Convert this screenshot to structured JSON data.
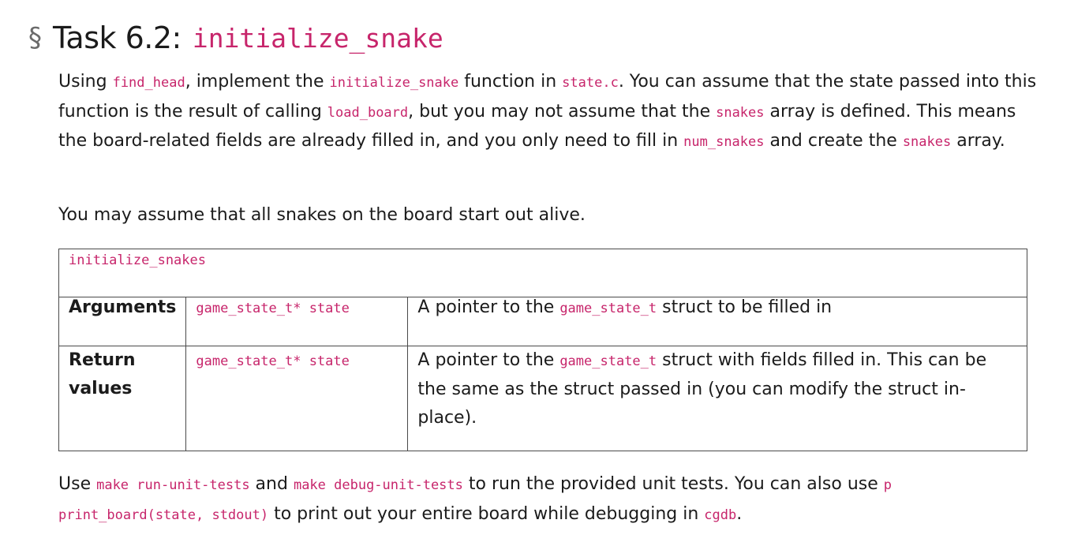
{
  "heading": {
    "symbol": "§",
    "text": "Task 6.2:",
    "code": "initialize_snake"
  },
  "para1": {
    "s1": "Using ",
    "c1": "find_head",
    "s2": ", implement the ",
    "c2": "initialize_snake",
    "s3": " function in ",
    "c3": "state.c",
    "s4": ". You can assume that the state passed into this function is the result of calling ",
    "c4": "load_board",
    "s5": ", but you may not assume that the ",
    "c5": "snakes",
    "s6": " array is defined. This means the board-related fields are already filled in, and you only need to fill in ",
    "c6": "num_snakes",
    "s7": " and create the ",
    "c7": "snakes",
    "s8": " array."
  },
  "para2": "You may assume that all snakes on the board start out alive.",
  "table": {
    "header": "initialize_snakes",
    "rows": [
      {
        "label": "Arguments",
        "param": "game_state_t* state",
        "d1": "A pointer to the ",
        "dcode": "game_state_t",
        "d2": " struct to be filled in"
      },
      {
        "label": "Return values",
        "param": "game_state_t* state",
        "d1": "A pointer to the ",
        "dcode": "game_state_t",
        "d2": " struct with fields filled in. This can be the same as the struct passed in (you can modify the struct in-place)."
      }
    ]
  },
  "para3": {
    "s1": "Use ",
    "c1": "make run-unit-tests",
    "s2": " and ",
    "c2": "make debug-unit-tests",
    "s3": " to run the provided unit tests. You can also use ",
    "c3": "p print_board(state, stdout)",
    "s4": " to print out your entire board while debugging in ",
    "c4": "cgdb",
    "s5": "."
  }
}
